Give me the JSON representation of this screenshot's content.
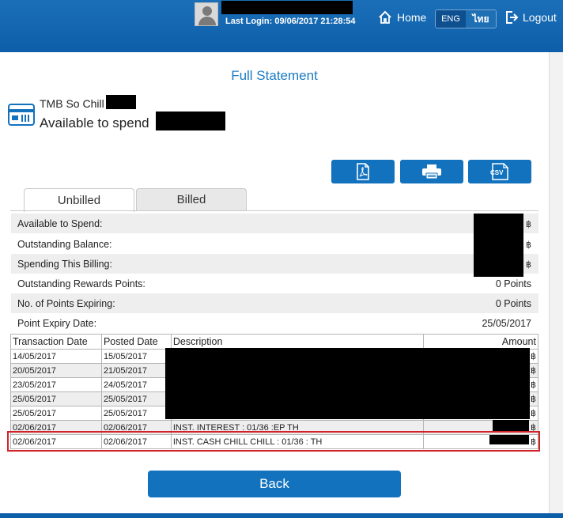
{
  "header": {
    "last_login": "Last Login: 09/06/2017 21:28:54",
    "home_label": "Home",
    "lang_eng": "ENG",
    "lang_thai": "ไทย",
    "logout_label": "Logout"
  },
  "page": {
    "title": "Full Statement",
    "card_name": "TMB So Chill",
    "available_label": "Available to spend"
  },
  "actions": {
    "csv_label": "CSV"
  },
  "tabs": {
    "unbilled": "Unbilled",
    "billed": "Billed"
  },
  "summary": {
    "currency": "฿",
    "rows": [
      {
        "label": "Available to Spend:",
        "value": ""
      },
      {
        "label": "Outstanding Balance:",
        "value": ""
      },
      {
        "label": "Spending This Billing:",
        "value": ""
      },
      {
        "label": "Outstanding Rewards Points:",
        "value": "0 Points"
      },
      {
        "label": "No. of Points Expiring:",
        "value": "0 Points"
      },
      {
        "label": "Point Expiry Date:",
        "value": "25/05/2017"
      }
    ]
  },
  "transactions": {
    "headers": [
      "Transaction Date",
      "Posted Date",
      "Description",
      "Amount"
    ],
    "rows": [
      {
        "tx_date": "14/05/2017",
        "posted": "15/05/2017",
        "desc": "",
        "amount": "฿"
      },
      {
        "tx_date": "20/05/2017",
        "posted": "21/05/2017",
        "desc": "",
        "amount": "฿"
      },
      {
        "tx_date": "23/05/2017",
        "posted": "24/05/2017",
        "desc": "",
        "amount": "฿"
      },
      {
        "tx_date": "25/05/2017",
        "posted": "25/05/2017",
        "desc": "",
        "amount": "฿"
      },
      {
        "tx_date": "25/05/2017",
        "posted": "25/05/2017",
        "desc": "",
        "amount": "฿"
      },
      {
        "tx_date": "02/06/2017",
        "posted": "02/06/2017",
        "desc": "INST. INTEREST : 01/36 :EP TH",
        "amount": "฿"
      },
      {
        "tx_date": "02/06/2017",
        "posted": "02/06/2017",
        "desc": "INST. CASH CHILL CHILL : 01/36 : TH",
        "amount": "฿"
      }
    ]
  },
  "footer": {
    "back_label": "Back"
  },
  "colors": {
    "brand_blue": "#1372be",
    "title_blue": "#1d7cc4",
    "highlight_red": "#d2232a"
  },
  "icons": [
    "user-avatar-icon",
    "home-icon",
    "logout-icon",
    "credit-card-icon",
    "pdf-icon",
    "print-icon",
    "csv-icon"
  ]
}
